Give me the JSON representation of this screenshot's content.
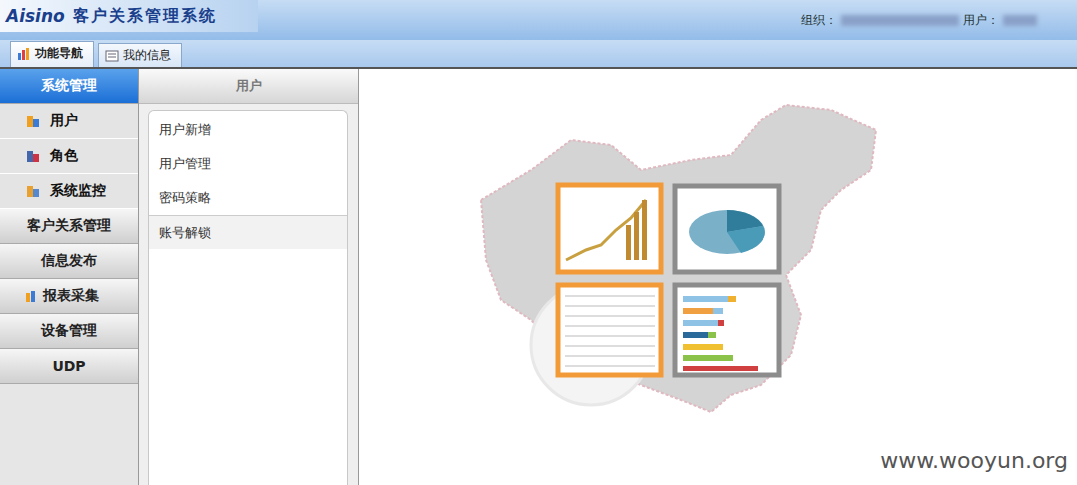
{
  "header": {
    "logo_brand": "Aisino",
    "logo_title": "客户关系管理系统",
    "org_label": "组织：",
    "user_label": "用户："
  },
  "tabs": [
    {
      "label": "功能导航",
      "selected": true
    },
    {
      "label": "我的信息",
      "selected": false
    }
  ],
  "sidebar": {
    "sections": [
      {
        "label": "系统管理",
        "selected": true,
        "expanded": true,
        "has_icon": false,
        "items": [
          {
            "label": "用户"
          },
          {
            "label": "角色"
          },
          {
            "label": "系统监控"
          }
        ]
      },
      {
        "label": "客户关系管理",
        "selected": false,
        "expanded": false,
        "has_icon": false,
        "items": []
      },
      {
        "label": "信息发布",
        "selected": false,
        "expanded": false,
        "has_icon": false,
        "items": []
      },
      {
        "label": "报表采集",
        "selected": false,
        "expanded": false,
        "has_icon": true,
        "items": []
      },
      {
        "label": "设备管理",
        "selected": false,
        "expanded": false,
        "has_icon": false,
        "items": []
      },
      {
        "label": "UDP",
        "selected": false,
        "expanded": false,
        "has_icon": false,
        "items": []
      }
    ]
  },
  "panel": {
    "title": "用户",
    "items": [
      {
        "label": "用户新增",
        "highlighted": false,
        "separated": false
      },
      {
        "label": "用户管理",
        "highlighted": false,
        "separated": false
      },
      {
        "label": "密码策略",
        "highlighted": false,
        "separated": false
      },
      {
        "label": "账号解锁",
        "highlighted": true,
        "separated": true
      }
    ]
  },
  "watermark": "www.wooyun.org"
}
